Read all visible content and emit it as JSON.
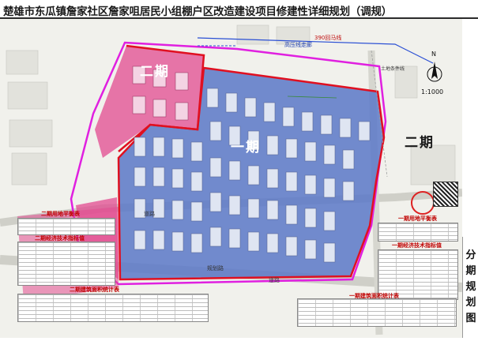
{
  "header": {
    "title": "楚雄市东瓜镇詹家社区詹家咀居民小组棚户区改造建设项目修建性详细规划（调规）"
  },
  "sidebar": {
    "label": "分期规划图"
  },
  "map": {
    "scale_text": "1:1000",
    "north_letter": "N",
    "phase_one_label": "一期",
    "phase_two_label_left": "二期",
    "phase_two_label_right": "二期",
    "hv_line_label": "高压线走廊",
    "hv_tower_label": "390回马线",
    "land_boundary_label": "土地条件线",
    "road_north_label": "道路",
    "road_south_label": "规划路",
    "road_south_right_label": "道路",
    "road_west_label": "道路"
  },
  "tables": {
    "left_land_title": "二期用地平衡表",
    "left_econ_title": "二期经济技术指标值",
    "left_build_title": "二期建筑面积统计表",
    "right_land_title": "一期用地平衡表",
    "right_econ_title": "一期经济技术指标值",
    "right_build_title": "一期建筑面积统计表"
  },
  "colors": {
    "phase_one_fill": "#5a78c8",
    "phase_two_fill": "#e0488f",
    "boundary_red": "#e01020",
    "site_outline_magenta": "#e020e0",
    "paper": "#f4f4f0"
  }
}
